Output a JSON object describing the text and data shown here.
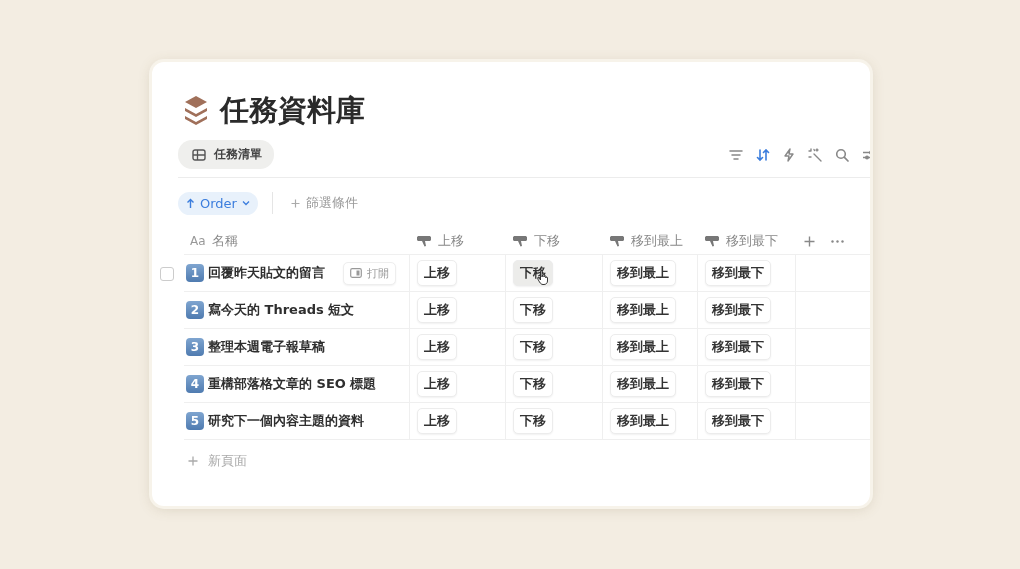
{
  "database": {
    "title": "任務資料庫"
  },
  "views": [
    {
      "label": "任務清單",
      "selected": true
    }
  ],
  "toolbar": {
    "sort_active": true
  },
  "sort_chip": {
    "label": "Order"
  },
  "filter": {
    "label": "篩選條件"
  },
  "columns": [
    {
      "kind": "title",
      "glyph": "Aa",
      "label": "名稱"
    },
    {
      "kind": "button",
      "label": "上移"
    },
    {
      "kind": "button",
      "label": "下移"
    },
    {
      "kind": "button",
      "label": "移到最上"
    },
    {
      "kind": "button",
      "label": "移到最下"
    }
  ],
  "rows": [
    {
      "number": "1",
      "title": "回覆昨天貼文的留言",
      "hovered": true,
      "open_label": "打開",
      "buttons": [
        {
          "label": "上移",
          "hovered": false
        },
        {
          "label": "下移",
          "hovered": true
        },
        {
          "label": "移到最上",
          "hovered": false
        },
        {
          "label": "移到最下",
          "hovered": false
        }
      ]
    },
    {
      "number": "2",
      "title": "寫今天的 Threads 短文",
      "hovered": false,
      "buttons": [
        {
          "label": "上移",
          "hovered": false
        },
        {
          "label": "下移",
          "hovered": false
        },
        {
          "label": "移到最上",
          "hovered": false
        },
        {
          "label": "移到最下",
          "hovered": false
        }
      ]
    },
    {
      "number": "3",
      "title": "整理本週電子報草稿",
      "hovered": false,
      "buttons": [
        {
          "label": "上移",
          "hovered": false
        },
        {
          "label": "下移",
          "hovered": false
        },
        {
          "label": "移到最上",
          "hovered": false
        },
        {
          "label": "移到最下",
          "hovered": false
        }
      ]
    },
    {
      "number": "4",
      "title": "重構部落格文章的 SEO 標題",
      "hovered": false,
      "buttons": [
        {
          "label": "上移",
          "hovered": false
        },
        {
          "label": "下移",
          "hovered": false
        },
        {
          "label": "移到最上",
          "hovered": false
        },
        {
          "label": "移到最下",
          "hovered": false
        }
      ]
    },
    {
      "number": "5",
      "title": "研究下一個內容主題的資料",
      "hovered": false,
      "buttons": [
        {
          "label": "上移",
          "hovered": false
        },
        {
          "label": "下移",
          "hovered": false
        },
        {
          "label": "移到最上",
          "hovered": false
        },
        {
          "label": "移到最下",
          "hovered": false
        }
      ]
    }
  ],
  "new_page": {
    "label": "新頁面"
  }
}
